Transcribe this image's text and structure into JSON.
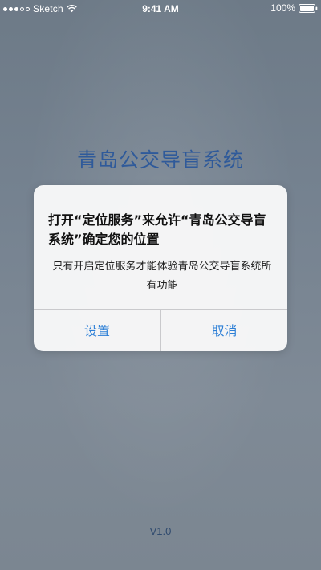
{
  "status_bar": {
    "carrier": "Sketch",
    "time": "9:41 AM",
    "battery": "100%",
    "signal_bars": 3,
    "signal_total": 5
  },
  "app": {
    "title": "青岛公交导盲系统",
    "version": "V1.0"
  },
  "alert": {
    "title": "打开“定位服务”来允许“青岛公交导盲系统”确定您的位置",
    "message": "只有开启定位服务才能体验青岛公交导盲系统所有功能",
    "buttons": {
      "settings": "设置",
      "cancel": "取消"
    }
  },
  "colors": {
    "title": "#2f5a9a",
    "button": "#2d7fd6",
    "alert_bg": "#f6f6f7"
  },
  "icons": [
    "signal-dots-icon",
    "wifi-icon",
    "battery-icon"
  ]
}
